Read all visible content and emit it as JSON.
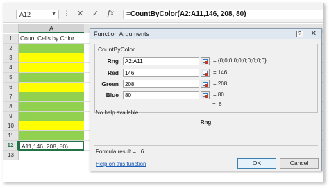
{
  "formula_bar": {
    "name_box": "A12",
    "cancel_symbol": "✕",
    "enter_symbol": "✓",
    "fx_label": "fx",
    "formula": "=CountByColor(A2:A11,146, 208, 80)"
  },
  "sheet": {
    "column_header": "A",
    "rows": [
      {
        "num": "1",
        "text": "Count Cells by Color",
        "fill": "#ffffff"
      },
      {
        "num": "2",
        "text": "",
        "fill": "#92d050"
      },
      {
        "num": "3",
        "text": "",
        "fill": "#ffff00"
      },
      {
        "num": "4",
        "text": "",
        "fill": "#ffff00"
      },
      {
        "num": "5",
        "text": "",
        "fill": "#92d050"
      },
      {
        "num": "6",
        "text": "",
        "fill": "#ffff00"
      },
      {
        "num": "7",
        "text": "",
        "fill": "#92d050"
      },
      {
        "num": "8",
        "text": "",
        "fill": "#92d050"
      },
      {
        "num": "9",
        "text": "",
        "fill": "#92d050"
      },
      {
        "num": "10",
        "text": "",
        "fill": "#ffff00"
      },
      {
        "num": "11",
        "text": "",
        "fill": "#92d050"
      },
      {
        "num": "12",
        "text": "A11,146, 208, 80)",
        "fill": "#ffffff"
      },
      {
        "num": "13",
        "text": "",
        "fill": "#ffffff"
      }
    ],
    "selected_row": "12",
    "colors": {
      "green": "#92d050",
      "yellow": "#ffff00",
      "accent": "#217346"
    }
  },
  "dialog": {
    "title": "Function Arguments",
    "help_btn": "?",
    "close_btn": "✕",
    "function_name": "CountByColor",
    "args": [
      {
        "label": "Rng",
        "value": "A2:A11",
        "result": "{0;0;0;0;0;0;0;0;0;0}"
      },
      {
        "label": "Red",
        "value": "146",
        "result": "146"
      },
      {
        "label": "Green",
        "value": "208",
        "result": "208"
      },
      {
        "label": "Blue",
        "value": "80",
        "result": "80"
      }
    ],
    "eq": "=",
    "result_preview": "6",
    "no_help": "No help available.",
    "arg_name": "Rng",
    "formula_result_label": "Formula result =",
    "formula_result": "6",
    "help_link": "Help on this function",
    "ok_label": "OK",
    "cancel_label": "Cancel"
  }
}
